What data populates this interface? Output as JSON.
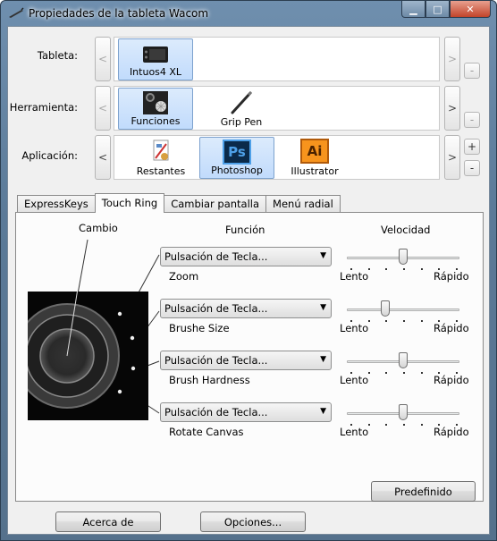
{
  "window": {
    "title": "Propiedades de la tableta Wacom"
  },
  "rows": {
    "tableta": {
      "label": "Tableta:",
      "items": [
        {
          "label": "Intuos4 XL",
          "icon": "tablet-icon",
          "selected": true
        }
      ]
    },
    "herramienta": {
      "label": "Herramienta:",
      "items": [
        {
          "label": "Funciones",
          "icon": "functions-icon",
          "selected": true
        },
        {
          "label": "Grip Pen",
          "icon": "pen-icon",
          "selected": false
        }
      ]
    },
    "aplicacion": {
      "label": "Aplicación:",
      "items": [
        {
          "label": "Restantes",
          "icon": "all-apps-icon",
          "selected": false
        },
        {
          "label": "Photoshop",
          "icon": "photoshop-icon",
          "selected": true
        },
        {
          "label": "Illustrator",
          "icon": "illustrator-icon",
          "selected": false
        }
      ]
    }
  },
  "icons": {
    "photoshop_text": "Ps",
    "illustrator_text": "Ai",
    "ps_color": "#0b2a4a",
    "ai_color": "#f7941d"
  },
  "tabs": [
    "ExpressKeys",
    "Touch Ring",
    "Cambiar pantalla",
    "Menú radial"
  ],
  "active_tab": "Touch Ring",
  "panel": {
    "cambio_header": "Cambio",
    "funcion_header": "Función",
    "velocidad_header": "Velocidad",
    "functions": [
      {
        "action": "Pulsación de Tecla...",
        "label": "Zoom",
        "speed_level": 0.5
      },
      {
        "action": "Pulsación de Tecla...",
        "label": "Brushe Size",
        "speed_level": 0.33
      },
      {
        "action": "Pulsación de Tecla...",
        "label": "Brush Hardness",
        "speed_level": 0.5
      },
      {
        "action": "Pulsación de Tecla...",
        "label": "Rotate Canvas",
        "speed_level": 0.5
      }
    ],
    "slow_label": "Lento",
    "fast_label": "Rápido",
    "default_button": "Predefinido"
  },
  "footer": {
    "about_button": "Acerca de",
    "options_button": "Opciones..."
  }
}
